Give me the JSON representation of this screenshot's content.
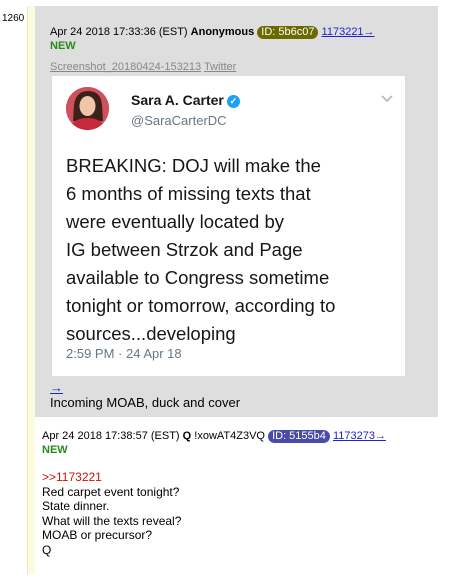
{
  "post1": {
    "number": "1260",
    "date": "Apr 24 2018 17:33:36 (EST)",
    "name": "Anonymous",
    "id_badge": "ID: 5b6c07",
    "id_color": "#6a6a00",
    "reply_link": "1173221→",
    "new_label": "NEW",
    "file_link_1": "Screenshot_20180424-153213",
    "file_link_2": "Twitter",
    "arrow": "→",
    "message": "Incoming MOAB, duck and cover"
  },
  "tweet": {
    "name": "Sara A. Carter",
    "verified_icon": "verified-check-icon",
    "handle": "@SaraCarterDC",
    "text": "BREAKING: DOJ will make the\n6 months of missing texts that\nwere eventually located by\nIG between Strzok and Page\navailable to Congress sometime\ntonight or tomorrow, according to\nsources...developing",
    "time": "2:59 PM · 24 Apr 18",
    "chevron_icon": "chevron-down-icon"
  },
  "post2": {
    "date": "Apr 24 2018 17:38:57 (EST)",
    "name": "Q",
    "tripcode": "!xowAT4Z3VQ",
    "id_badge": "ID: 5155b4",
    "id_color": "#4a4aa8",
    "reply_link": "1173273→",
    "new_label": "NEW",
    "quote": ">>1173221",
    "lines": [
      "Red carpet event tonight?",
      "State dinner.",
      "What will the texts reveal?",
      "MOAB or precursor?",
      "Q"
    ]
  }
}
